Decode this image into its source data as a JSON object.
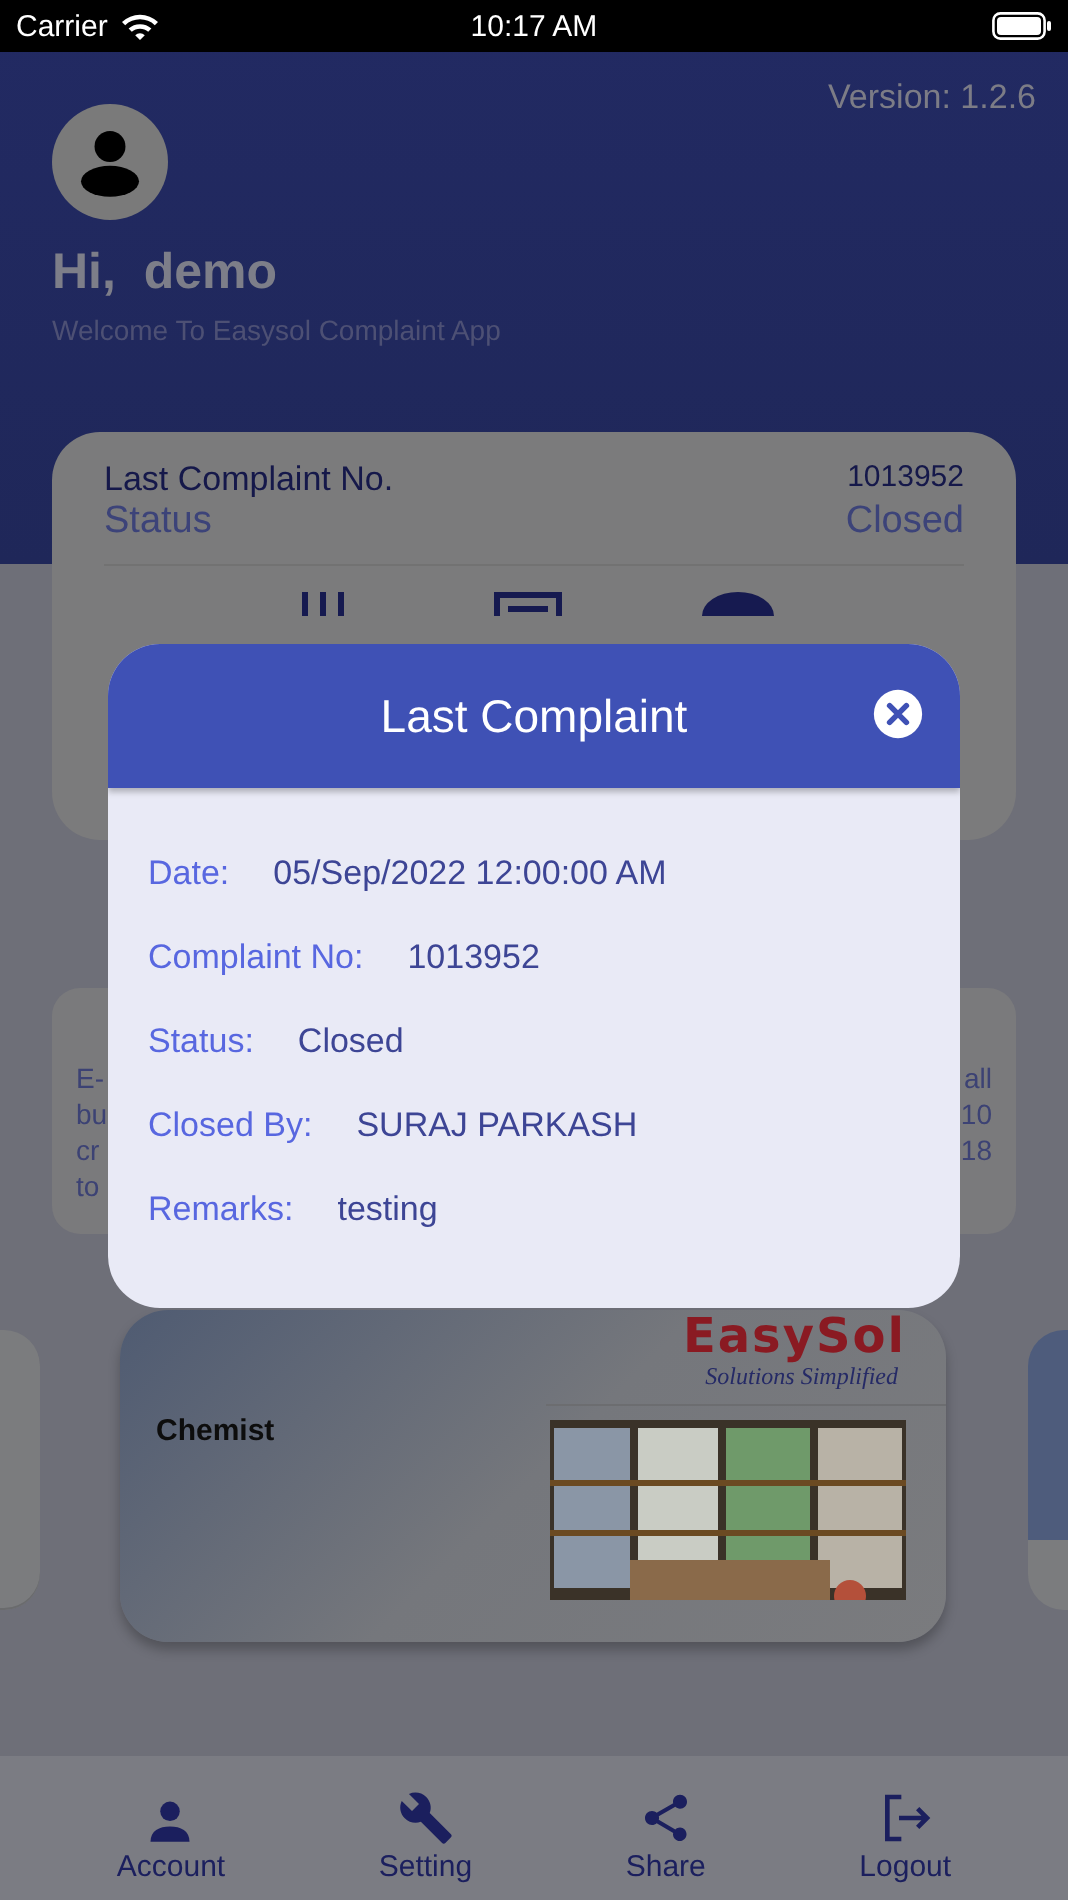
{
  "status_bar": {
    "carrier": "Carrier",
    "time": "10:17 AM"
  },
  "header": {
    "version": "Version: 1.2.6",
    "greeting": "Hi,  demo",
    "subtitle": "Welcome To Easysol Complaint App"
  },
  "last_complaint_card": {
    "number_label": "Last Complaint No.",
    "number": "1013952",
    "status_label": "Status",
    "status": "Closed"
  },
  "info_card": {
    "left_fragments": [
      "E-",
      "bu",
      "cr",
      "to"
    ],
    "right_fragments": [
      "all",
      "10",
      "18"
    ]
  },
  "category_card": {
    "title": "Chemist",
    "logo": "EasySol",
    "tagline": "Solutions Simplified"
  },
  "dialog": {
    "title": "Last Complaint",
    "fields": [
      {
        "label": "Date:",
        "value": "05/Sep/2022 12:00:00 AM"
      },
      {
        "label": "Complaint No:",
        "value": "1013952"
      },
      {
        "label": "Status:",
        "value": "Closed"
      },
      {
        "label": "Closed By:",
        "value": "SURAJ PARKASH"
      },
      {
        "label": "Remarks:",
        "value": "testing"
      }
    ]
  },
  "bottom_nav": [
    {
      "label": "Account",
      "kind": "account"
    },
    {
      "label": "Setting",
      "kind": "setting"
    },
    {
      "label": "Share",
      "kind": "share"
    },
    {
      "label": "Logout",
      "kind": "logout"
    }
  ]
}
